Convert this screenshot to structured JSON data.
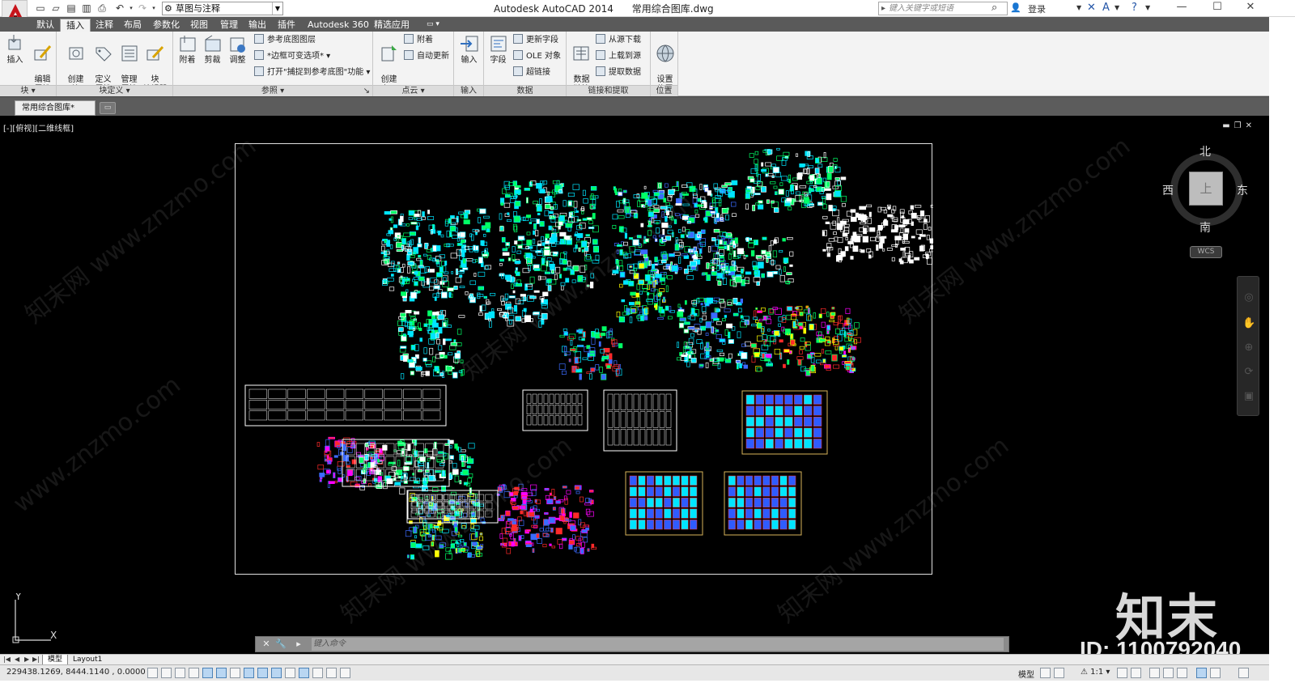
{
  "app": {
    "title": "Autodesk AutoCAD 2014      常用综合图库.dwg",
    "workspace": "草图与注释",
    "search_placeholder": "键入关键字或短语",
    "login_label": "登录"
  },
  "ribbon_tabs": [
    "默认",
    "插入",
    "注释",
    "布局",
    "参数化",
    "视图",
    "管理",
    "输出",
    "插件",
    "Autodesk 360",
    "精选应用"
  ],
  "active_tab": "插入",
  "panels": {
    "block": {
      "title": "块",
      "buttons": [
        "插入",
        "编辑\n属性"
      ]
    },
    "block_def": {
      "title": "块定义",
      "buttons": [
        "创建\n块",
        "定义\n属性",
        "管理\n属性",
        "块\n编辑器"
      ]
    },
    "reference": {
      "title": "参照",
      "buttons": [
        "附着",
        "剪裁",
        "调整"
      ],
      "small": [
        "参考底图图层",
        "*边框可变选项*",
        "打开\"捕捉到参考底图\"功能"
      ]
    },
    "point_cloud": {
      "title": "点云",
      "buttons": [
        "创建\n点云"
      ],
      "small": [
        "附着",
        "自动更新"
      ]
    },
    "import": {
      "title": "输入",
      "buttons": [
        "输入"
      ]
    },
    "data": {
      "title": "数据",
      "buttons": [
        "字段"
      ],
      "small": [
        "更新字段",
        "OLE 对象",
        "超链接"
      ]
    },
    "linking": {
      "title": "链接和提取",
      "buttons": [
        "数据\n链接"
      ],
      "small": [
        "从源下载",
        "上载到源",
        "提取数据"
      ]
    },
    "location": {
      "title": "位置",
      "buttons": [
        "设置\n位置"
      ]
    }
  },
  "doc_tab": "常用综合图库*",
  "viewport": {
    "label": "[-][俯视][二维线框]",
    "compass": {
      "north": "北",
      "south": "南",
      "east": "东",
      "west": "西",
      "top": "上"
    },
    "wcs": "WCS",
    "ucs_x": "X",
    "ucs_y": "Y"
  },
  "command": {
    "placeholder": "键入命令"
  },
  "layout_tabs": [
    "模型",
    "Layout1"
  ],
  "status": {
    "coords": "229438.1269, 8444.1140 , 0.0000",
    "model_label": "模型",
    "scale": "1:1"
  },
  "watermark": {
    "site": "www.znzmo.com",
    "brand_cn": "知末网",
    "logo": "知末",
    "id": "ID: 1100792040"
  },
  "colors": {
    "accent": "#0a4fa6",
    "autocad_red": "#c8141b",
    "ribbon_tabs_bg": "#5a5a5a",
    "canvas": "#000000"
  }
}
